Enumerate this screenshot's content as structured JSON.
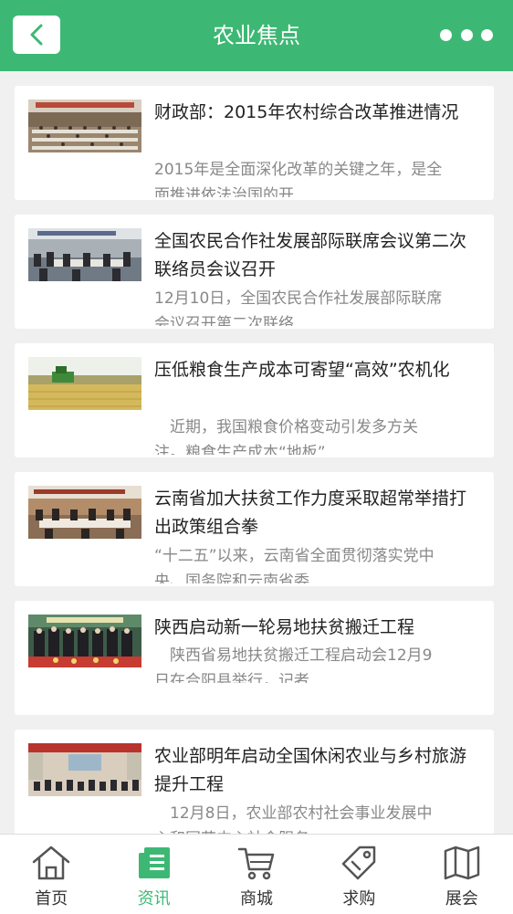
{
  "header": {
    "title": "农业焦点",
    "back_icon": "chevron-left-icon",
    "more_icon": "more-dots-icon"
  },
  "news": [
    {
      "title": "财政部：2015年农村综合改革推进情况",
      "desc": "2015年是全面深化改革的关键之年，是全面推进依法治国的开",
      "image": "conference-hall-photo"
    },
    {
      "title": "全国农民合作社发展部际联席会议第二次联络员会议召开",
      "desc": "12月10日，全国农民合作社发展部际联席会议召开第二次联络",
      "image": "meeting-room-photo"
    },
    {
      "title": "压低粮食生产成本可寄望“高效”农机化",
      "desc": "　近期，我国粮食价格变动引发多方关注。粮食生产成本“地板”",
      "image": "harvester-field-photo"
    },
    {
      "title": "云南省加大扶贫工作力度采取超常举措打出政策组合拳",
      "desc": "“十二五”以来，云南省全面贯彻落实党中央、国务院和云南省委",
      "image": "meeting-room-photo"
    },
    {
      "title": "陕西启动新一轮易地扶贫搬迁工程",
      "desc": "　陕西省易地扶贫搬迁工程启动会12月9日在合阳县举行，记者",
      "image": "ceremony-group-photo"
    },
    {
      "title": "农业部明年启动全国休闲农业与乡村旅游提升工程",
      "desc": "　12月8日，农业部农村社会事业发展中心和国花中心社会服务",
      "image": "auditorium-photo"
    }
  ],
  "tabbar": [
    {
      "label": "首页",
      "icon": "home-icon",
      "active": false
    },
    {
      "label": "资讯",
      "icon": "news-icon",
      "active": true
    },
    {
      "label": "商城",
      "icon": "cart-icon",
      "active": false
    },
    {
      "label": "求购",
      "icon": "tag-icon",
      "active": false
    },
    {
      "label": "展会",
      "icon": "map-icon",
      "active": false
    }
  ],
  "colors": {
    "brand": "#3db874",
    "text": "#222222",
    "muted": "#888888",
    "background": "#f0f0f0"
  }
}
